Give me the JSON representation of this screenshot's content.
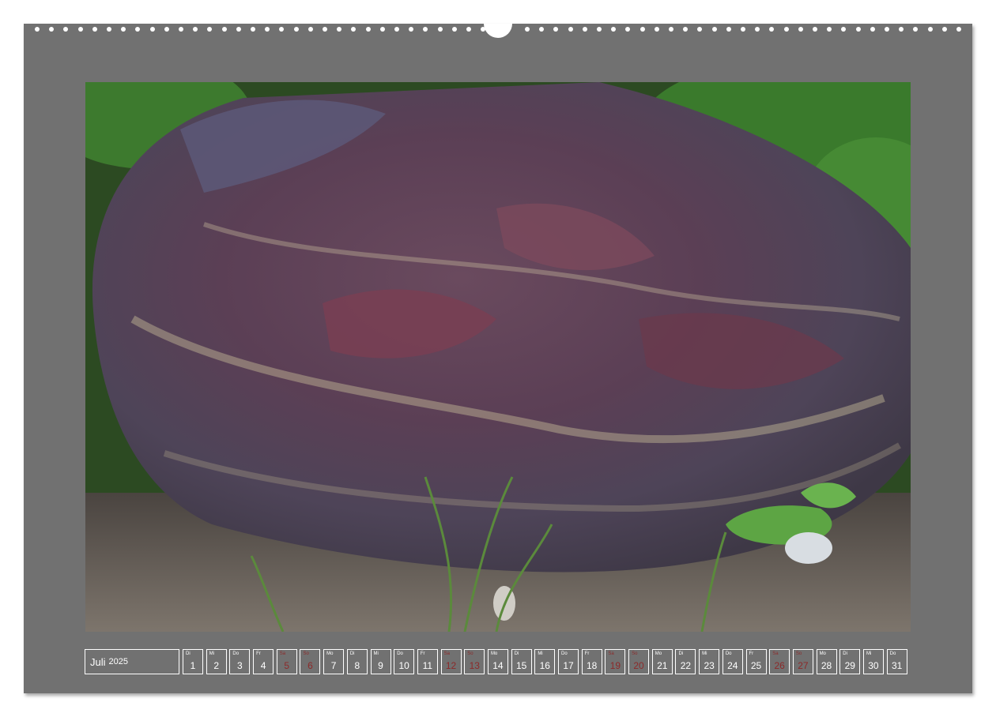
{
  "calendar": {
    "month": "Juli",
    "year": "2025",
    "days": [
      {
        "wd": "Di",
        "d": "1",
        "weekend": false
      },
      {
        "wd": "Mi",
        "d": "2",
        "weekend": false
      },
      {
        "wd": "Do",
        "d": "3",
        "weekend": false
      },
      {
        "wd": "Fr",
        "d": "4",
        "weekend": false
      },
      {
        "wd": "Sa",
        "d": "5",
        "weekend": true
      },
      {
        "wd": "So",
        "d": "6",
        "weekend": true
      },
      {
        "wd": "Mo",
        "d": "7",
        "weekend": false
      },
      {
        "wd": "Di",
        "d": "8",
        "weekend": false
      },
      {
        "wd": "Mi",
        "d": "9",
        "weekend": false
      },
      {
        "wd": "Do",
        "d": "10",
        "weekend": false
      },
      {
        "wd": "Fr",
        "d": "11",
        "weekend": false
      },
      {
        "wd": "Sa",
        "d": "12",
        "weekend": true
      },
      {
        "wd": "So",
        "d": "13",
        "weekend": true
      },
      {
        "wd": "Mo",
        "d": "14",
        "weekend": false
      },
      {
        "wd": "Di",
        "d": "15",
        "weekend": false
      },
      {
        "wd": "Mi",
        "d": "16",
        "weekend": false
      },
      {
        "wd": "Do",
        "d": "17",
        "weekend": false
      },
      {
        "wd": "Fr",
        "d": "18",
        "weekend": false
      },
      {
        "wd": "Sa",
        "d": "19",
        "weekend": true
      },
      {
        "wd": "So",
        "d": "20",
        "weekend": true
      },
      {
        "wd": "Mo",
        "d": "21",
        "weekend": false
      },
      {
        "wd": "Di",
        "d": "22",
        "weekend": false
      },
      {
        "wd": "Mi",
        "d": "23",
        "weekend": false
      },
      {
        "wd": "Do",
        "d": "24",
        "weekend": false
      },
      {
        "wd": "Fr",
        "d": "25",
        "weekend": false
      },
      {
        "wd": "Sa",
        "d": "26",
        "weekend": true
      },
      {
        "wd": "So",
        "d": "27",
        "weekend": true
      },
      {
        "wd": "Mo",
        "d": "28",
        "weekend": false
      },
      {
        "wd": "Di",
        "d": "29",
        "weekend": false
      },
      {
        "wd": "Mi",
        "d": "30",
        "weekend": false
      },
      {
        "wd": "Do",
        "d": "31",
        "weekend": false
      }
    ]
  },
  "colors": {
    "sheet": "#717171",
    "weekend": "#8c2a2a",
    "text": "#ffffff"
  }
}
